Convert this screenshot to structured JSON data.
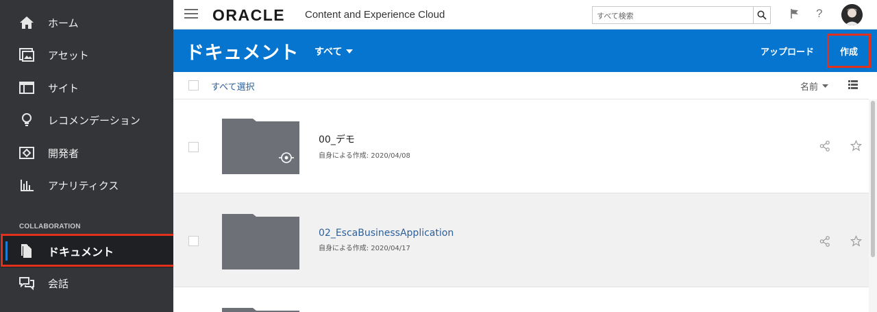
{
  "sidebar": {
    "items": [
      {
        "label": "ホーム",
        "icon": "home-icon"
      },
      {
        "label": "アセット",
        "icon": "assets-icon"
      },
      {
        "label": "サイト",
        "icon": "sites-icon"
      },
      {
        "label": "レコメンデーション",
        "icon": "lightbulb-icon"
      },
      {
        "label": "開発者",
        "icon": "developer-icon"
      },
      {
        "label": "アナリティクス",
        "icon": "analytics-icon"
      }
    ],
    "section_label": "COLLABORATION",
    "collab_items": [
      {
        "label": "ドキュメント",
        "icon": "document-icon"
      },
      {
        "label": "会話",
        "icon": "conversation-icon"
      }
    ]
  },
  "topbar": {
    "logo": "ORACLE",
    "app_name": "Content and Experience Cloud",
    "search_placeholder": "すべて検索"
  },
  "header": {
    "title": "ドキュメント",
    "filter": "すべて",
    "upload_label": "アップロード",
    "create_label": "作成"
  },
  "toolbar": {
    "select_all": "すべて選択",
    "sort_label": "名前"
  },
  "rows": [
    {
      "name": "00_デモ",
      "meta": "自身による作成: 2020/04/08",
      "shared": true
    },
    {
      "name": "02_EscaBusinessApplication",
      "meta": "自身による作成: 2020/04/17",
      "shared": false
    }
  ],
  "colors": {
    "sidebar_bg": "#333538",
    "header_blue": "#0575d0",
    "highlight": "#e1301c",
    "link": "#2c5f9a",
    "folder": "#6e7078"
  }
}
